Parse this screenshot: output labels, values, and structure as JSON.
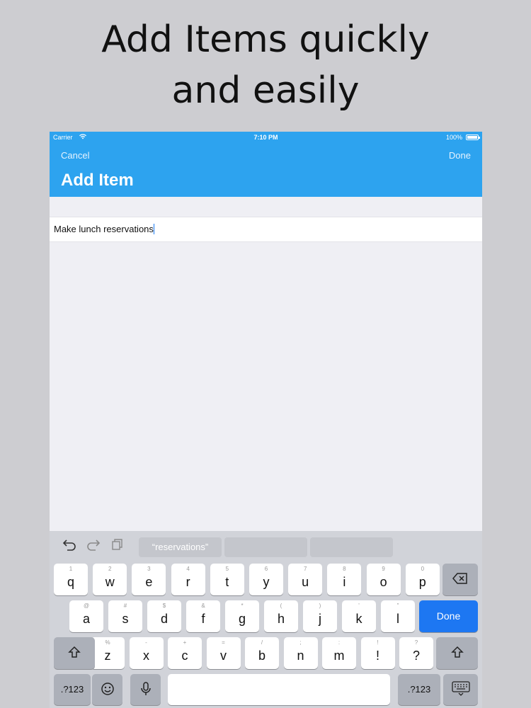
{
  "headline": {
    "line1": "Add Items quickly",
    "line2": "and easily"
  },
  "status": {
    "carrier": "Carrier",
    "time": "7:10 PM",
    "battery": "100%"
  },
  "nav": {
    "cancel": "Cancel",
    "done": "Done",
    "title": "Add Item"
  },
  "field": {
    "value": "Make lunch reservations"
  },
  "keyboard": {
    "suggestion": "“reservations”",
    "row1": [
      {
        "key": "q",
        "sub": "1"
      },
      {
        "key": "w",
        "sub": "2"
      },
      {
        "key": "e",
        "sub": "3"
      },
      {
        "key": "r",
        "sub": "4"
      },
      {
        "key": "t",
        "sub": "5"
      },
      {
        "key": "y",
        "sub": "6"
      },
      {
        "key": "u",
        "sub": "7"
      },
      {
        "key": "i",
        "sub": "8"
      },
      {
        "key": "o",
        "sub": "9"
      },
      {
        "key": "p",
        "sub": "0"
      }
    ],
    "row2": [
      {
        "key": "a",
        "sub": "@"
      },
      {
        "key": "s",
        "sub": "#"
      },
      {
        "key": "d",
        "sub": "$"
      },
      {
        "key": "f",
        "sub": "&"
      },
      {
        "key": "g",
        "sub": "*"
      },
      {
        "key": "h",
        "sub": "("
      },
      {
        "key": "j",
        "sub": ")"
      },
      {
        "key": "k",
        "sub": "'"
      },
      {
        "key": "l",
        "sub": "\""
      }
    ],
    "row3": [
      {
        "key": "z",
        "sub": "%"
      },
      {
        "key": "x",
        "sub": "-"
      },
      {
        "key": "c",
        "sub": "+"
      },
      {
        "key": "v",
        "sub": "="
      },
      {
        "key": "b",
        "sub": "/"
      },
      {
        "key": "n",
        "sub": ";"
      },
      {
        "key": "m",
        "sub": ":"
      },
      {
        "key": "!",
        "sub": "!"
      },
      {
        "key": "?",
        "sub": "?"
      }
    ],
    "done_label": "Done",
    "numbers_label": ".?123",
    "row3_extra": [
      ",",
      "."
    ]
  }
}
